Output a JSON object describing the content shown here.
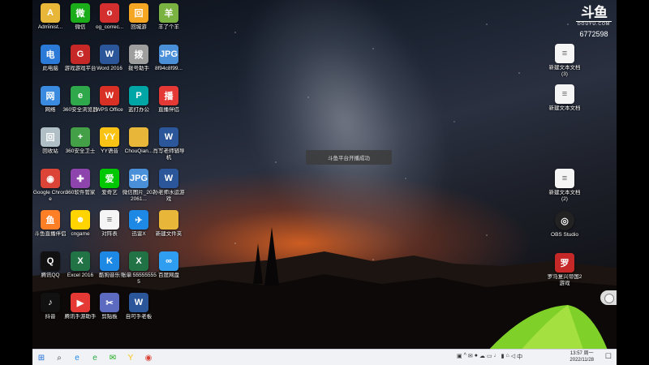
{
  "desktop_icons_left": [
    {
      "label": "Administ...",
      "icon": "user-folder-icon",
      "color": "#e8b73a",
      "glyph": "A"
    },
    {
      "label": "微信",
      "icon": "wechat-icon",
      "color": "#1aad19",
      "glyph": "微"
    },
    {
      "label": "og_correc...",
      "icon": "red-app-icon",
      "color": "#d32f2f",
      "glyph": "o"
    },
    {
      "label": "回城游",
      "icon": "game-icon",
      "color": "#f5a623",
      "glyph": "回"
    },
    {
      "label": "羊了个羊",
      "icon": "sheep-game-icon",
      "color": "#7ab342",
      "glyph": "羊"
    },
    {
      "label": "此电脑",
      "icon": "computer-icon",
      "color": "#2b7ad8",
      "glyph": "电"
    },
    {
      "label": "游戏游戏平台",
      "icon": "game-platform-icon",
      "color": "#c62828",
      "glyph": "G"
    },
    {
      "label": "Word 2016",
      "icon": "word-icon",
      "color": "#2b579a",
      "glyph": "W"
    },
    {
      "label": "拨号助手",
      "icon": "dialer-icon",
      "color": "#9e9e9e",
      "glyph": "拨"
    },
    {
      "label": "8f94c8f99...",
      "icon": "jpg-file-icon",
      "color": "#4a90d9",
      "glyph": "JPG"
    },
    {
      "label": "网络",
      "icon": "network-icon",
      "color": "#3a8be0",
      "glyph": "网"
    },
    {
      "label": "360安全浏览器",
      "icon": "360-browser-icon",
      "color": "#2ea84a",
      "glyph": "e"
    },
    {
      "label": "WPS Office",
      "icon": "wps-icon",
      "color": "#d93025",
      "glyph": "W"
    },
    {
      "label": "蓝打办公",
      "icon": "office-icon",
      "color": "#00a6a6",
      "glyph": "P"
    },
    {
      "label": "直播伴侣",
      "icon": "live-companion-icon",
      "color": "#e53935",
      "glyph": "播"
    },
    {
      "label": "回收站",
      "icon": "recycle-bin-icon",
      "color": "#b0bec5",
      "glyph": "回"
    },
    {
      "label": "360安全卫士",
      "icon": "360-guard-icon",
      "color": "#43a047",
      "glyph": "+"
    },
    {
      "label": "YY语音",
      "icon": "yy-icon",
      "color": "#f9c316",
      "glyph": "YY"
    },
    {
      "label": "ChouQian...",
      "icon": "folder-icon",
      "color": "#e8b73a",
      "glyph": ""
    },
    {
      "label": "肖写老师辅导机",
      "icon": "word-doc-icon",
      "color": "#2b579a",
      "glyph": "W"
    },
    {
      "label": "Google Chrome",
      "icon": "chrome-icon",
      "color": "#db4437",
      "glyph": "◉"
    },
    {
      "label": "360软件管家",
      "icon": "360-software-icon",
      "color": "#8e44ad",
      "glyph": "✚"
    },
    {
      "label": "爱奇艺",
      "icon": "iqiyi-icon",
      "color": "#00c800",
      "glyph": "爱"
    },
    {
      "label": "微信图片_2022061...",
      "icon": "jpg-file-icon",
      "color": "#4a90d9",
      "glyph": "JPG"
    },
    {
      "label": "孙老师水运游戏",
      "icon": "word-doc-icon",
      "color": "#2b579a",
      "glyph": "W"
    },
    {
      "label": "斗鱼直播伴侣",
      "icon": "douyu-icon",
      "color": "#ff7f27",
      "glyph": "鱼"
    },
    {
      "label": "cngame",
      "icon": "cngame-icon",
      "color": "#ffd400",
      "glyph": "☻"
    },
    {
      "label": "对阵表",
      "icon": "doc-icon",
      "color": "#f5f5f5",
      "glyph": "≡"
    },
    {
      "label": "迅雷X",
      "icon": "xunlei-icon",
      "color": "#1e88e5",
      "glyph": "✈"
    },
    {
      "label": "新建文件夹",
      "icon": "folder-icon",
      "color": "#e8b73a",
      "glyph": ""
    },
    {
      "label": "腾讯QQ",
      "icon": "qq-icon",
      "color": "#111111",
      "glyph": "Q"
    },
    {
      "label": "Excel 2016",
      "icon": "excel-icon",
      "color": "#217346",
      "glyph": "X"
    },
    {
      "label": "酷狗音乐",
      "icon": "kugou-icon",
      "color": "#1e88e5",
      "glyph": "K"
    },
    {
      "label": "账单 555555555",
      "icon": "excel-file-icon",
      "color": "#217346",
      "glyph": "X"
    },
    {
      "label": "百度网盘",
      "icon": "baidu-disk-icon",
      "color": "#2f9df0",
      "glyph": "∞"
    },
    {
      "label": "抖音",
      "icon": "douyin-icon",
      "color": "#111111",
      "glyph": "♪"
    },
    {
      "label": "腾讯手游助手",
      "icon": "tencent-game-icon",
      "color": "#e53935",
      "glyph": "▶"
    },
    {
      "label": "剪贴板",
      "icon": "clipboard-icon",
      "color": "#5c6bc0",
      "glyph": "✂"
    },
    {
      "label": "自可手老板",
      "icon": "word-doc-icon",
      "color": "#2b579a",
      "glyph": "W"
    }
  ],
  "desktop_icons_right": [
    {
      "label": "新建文本文档 (3)",
      "icon": "text-file-icon"
    },
    {
      "label": "新建文本文档",
      "icon": "text-file-icon"
    },
    {
      "label": "新建文本文档 (2)",
      "icon": "text-file-icon"
    },
    {
      "label": "OBS Studio",
      "icon": "obs-icon"
    },
    {
      "label": "罗马复兴帝国2游戏",
      "icon": "game-icon"
    }
  ],
  "toast": {
    "text": "斗鱼平台开播成功"
  },
  "douyu": {
    "logo": "斗鱼",
    "site": "DOUYU.COM",
    "room_id": "6772598"
  },
  "taskbar": {
    "apps": [
      {
        "name": "start-button",
        "glyph": "⊞",
        "color": "#1e6fd9"
      },
      {
        "name": "search-button",
        "glyph": "⌕",
        "color": "#333"
      },
      {
        "name": "edge-icon",
        "glyph": "e",
        "color": "#1e88e5"
      },
      {
        "name": "360-browser-taskbar-icon",
        "glyph": "e",
        "color": "#2ea84a"
      },
      {
        "name": "wechat-taskbar-icon",
        "glyph": "✉",
        "color": "#1aad19"
      },
      {
        "name": "yy-taskbar-icon",
        "glyph": "Y",
        "color": "#f9c316"
      },
      {
        "name": "chrome-taskbar-icon",
        "glyph": "◉",
        "color": "#db4437"
      }
    ],
    "clock_time": "13:57 周一",
    "clock_date": "2022/11/28"
  }
}
